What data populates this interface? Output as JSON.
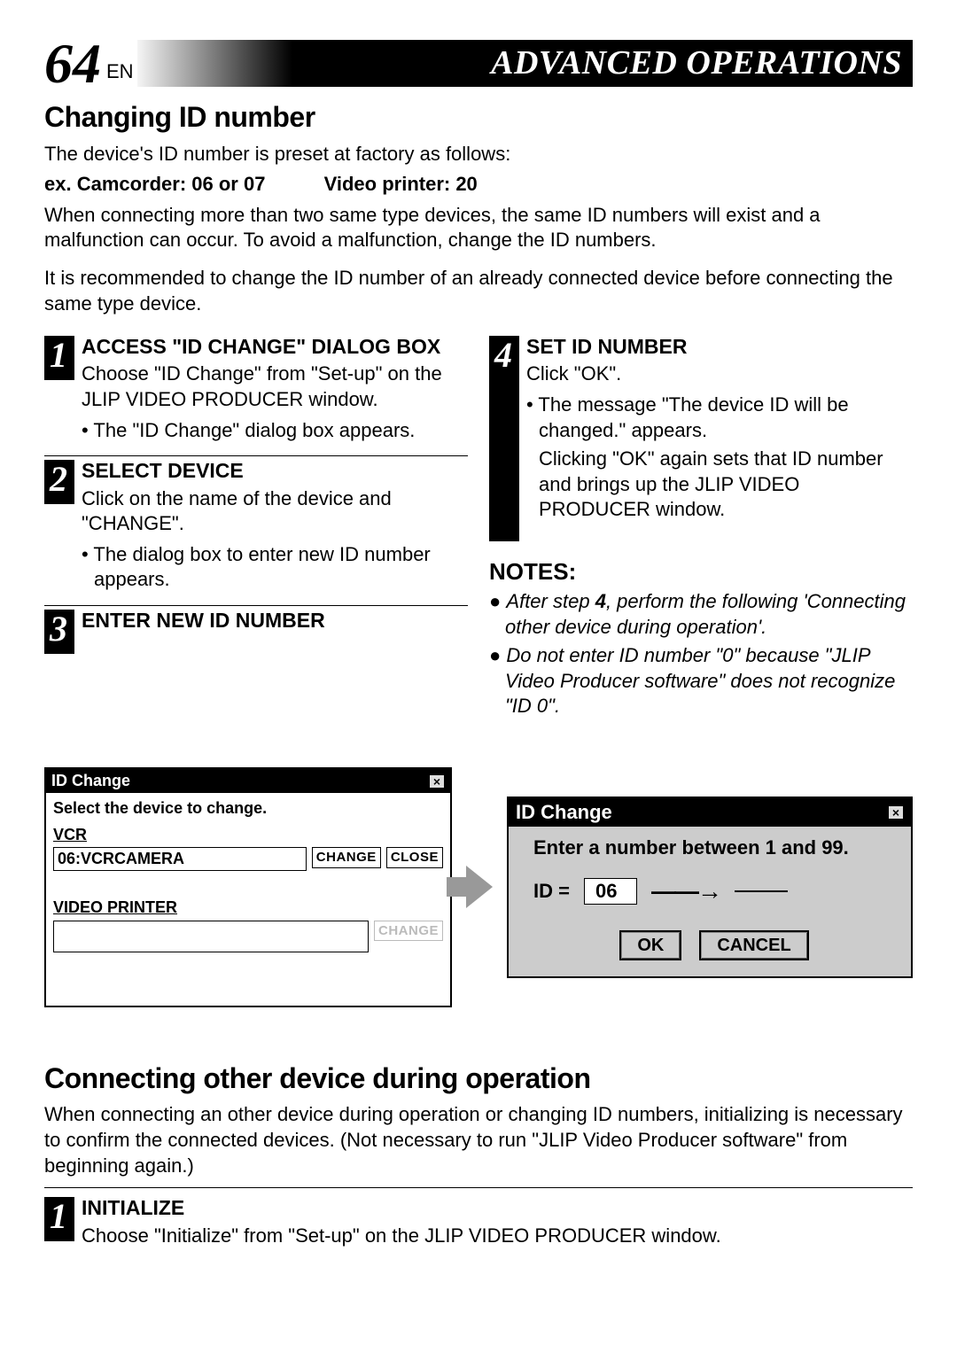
{
  "header": {
    "page_number": "64",
    "lang": "EN",
    "section_title": "ADVANCED OPERATIONS"
  },
  "section1": {
    "title": "Changing ID number",
    "intro": "The device's ID number is preset at factory as follows:",
    "example_line_1": "ex. Camcorder: 06 or 07",
    "example_line_2": "Video printer: 20",
    "para2": "When connecting more than two same type devices, the same ID numbers will exist and a malfunction can occur. To avoid a malfunction, change the ID numbers.",
    "para3": "It is recommended to change the ID number of an already connected device before connecting the same type device."
  },
  "steps": {
    "s1": {
      "num": "1",
      "head": "ACCESS \"ID CHANGE\" DIALOG BOX",
      "text": "Choose \"ID Change\" from \"Set-up\" on the JLIP VIDEO PRODUCER window.",
      "bullet": "The \"ID Change\" dialog box appears."
    },
    "s2": {
      "num": "2",
      "head": "SELECT DEVICE",
      "text": "Click on the name of the device and \"CHANGE\".",
      "bullet": "The dialog box to enter new ID number appears."
    },
    "s3": {
      "num": "3",
      "head": "ENTER NEW ID NUMBER"
    },
    "s4": {
      "num": "4",
      "head": "SET ID NUMBER",
      "text": "Click \"OK\".",
      "bullet": "The message \"The device ID will be changed.\" appears.",
      "after": "Clicking \"OK\" again sets that ID number and brings up the JLIP VIDEO PRODUCER window."
    }
  },
  "notes": {
    "head": "NOTES:",
    "n1_a": "After step ",
    "n1_step": "4",
    "n1_b": ", perform the following 'Connecting other device during operation'.",
    "n2": "Do not enter ID number \"0\" because \"JLIP Video Producer software\" does not recognize \"ID 0\"."
  },
  "dialog1": {
    "title": "ID Change",
    "close": "×",
    "instr": "Select the device to change.",
    "group1_label": "VCR",
    "group1_item": "06:VCRCAMERA",
    "change_btn": "CHANGE",
    "close_btn": "CLOSE",
    "group2_label": "VIDEO PRINTER"
  },
  "dialog2": {
    "title": "ID Change",
    "close": "×",
    "instr": "Enter a number between 1 and 99.",
    "id_label": "ID  =",
    "id_value": "06",
    "arrow_placeholder": "",
    "ok": "OK",
    "cancel": "CANCEL"
  },
  "section2": {
    "title": "Connecting other device during operation",
    "intro": "When connecting an other device during operation or changing ID numbers, initializing is necessary to confirm the connected devices. (Not necessary to run \"JLIP Video Producer software\" from beginning again.)",
    "step": {
      "num": "1",
      "head": "INITIALIZE",
      "text": "Choose \"Initialize\" from \"Set-up\" on the JLIP VIDEO PRODUCER window."
    }
  }
}
